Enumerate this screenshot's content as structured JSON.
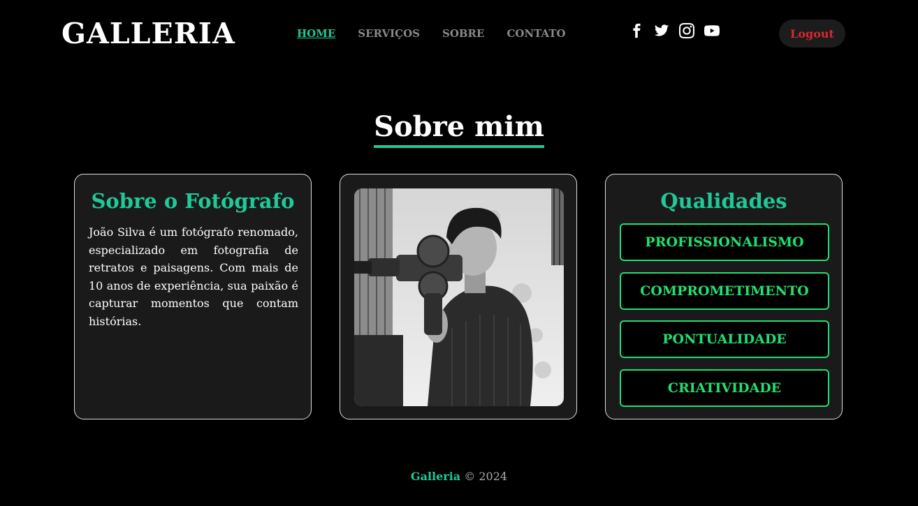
{
  "header": {
    "logo": "GALLERIA",
    "nav": [
      {
        "label": "HOME",
        "active": true
      },
      {
        "label": "SERVIÇOS",
        "active": false
      },
      {
        "label": "SOBRE",
        "active": false
      },
      {
        "label": "CONTATO",
        "active": false
      }
    ],
    "social": [
      "facebook-icon",
      "twitter-icon",
      "instagram-icon",
      "youtube-icon"
    ],
    "logout_label": "Logout"
  },
  "section": {
    "title": "Sobre mim"
  },
  "about_card": {
    "title": "Sobre o Fotógrafo",
    "text": "João Silva é um fotógrafo renomado, especializado em fotografia de retratos e paisagens. Com mais de 10 anos de experiência, sua paixão é capturar momentos que contam histórias."
  },
  "photo_card": {
    "image": "black-and-white photo of a man holding a film camera"
  },
  "qualities_card": {
    "title": "Qualidades",
    "items": [
      "PROFISSIONALISMO",
      "COMPROMETIMENTO",
      "PONTUALIDADE",
      "CRIATIVIDADE"
    ]
  },
  "footer": {
    "brand": "Galleria",
    "copyright": "© 2024"
  },
  "colors": {
    "accent": "#20c997",
    "quality_border": "#20e070",
    "logout_text": "#d9282f",
    "background": "#000000",
    "card_bg": "#1a1a1a"
  }
}
